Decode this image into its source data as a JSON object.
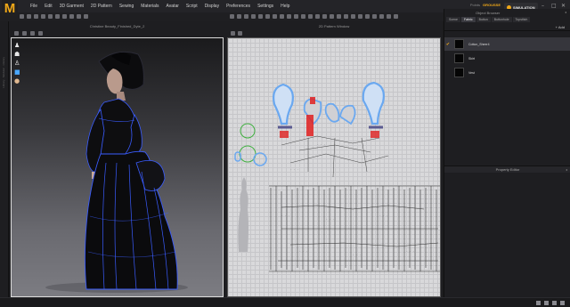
{
  "app": {
    "logo": "M"
  },
  "menu": [
    "File",
    "Edit",
    "3D Garment",
    "2D Pattern",
    "Sewing",
    "Materials",
    "Avatar",
    "Script",
    "Display",
    "Preferences",
    "Settings",
    "Help"
  ],
  "user": {
    "label": "Points",
    "name": "GROUSSE"
  },
  "simulation": {
    "label": "SIMULATION"
  },
  "view3d": {
    "title": "Christine Beauty_Finished_Dyte_2"
  },
  "view2d": {
    "title": "2D Pattern Window"
  },
  "object_browser": {
    "title": "Object Browser",
    "tabs": [
      "Scene",
      "Fabric",
      "Button",
      "Buttonhole",
      "Topstitch"
    ],
    "active_tab": "Fabric",
    "add_label": "+ Add",
    "fabrics": [
      {
        "name": "Cotton_Sheer4",
        "selected": true
      },
      {
        "name": "Skirt",
        "selected": false
      },
      {
        "name": "Vest",
        "selected": false
      }
    ]
  },
  "property_editor": {
    "title": "Property Editor"
  },
  "colors": {
    "accent": "#f0a818",
    "stitch": "#3a5cff",
    "selection": "#6aa8f0",
    "pin": "#e02020"
  }
}
